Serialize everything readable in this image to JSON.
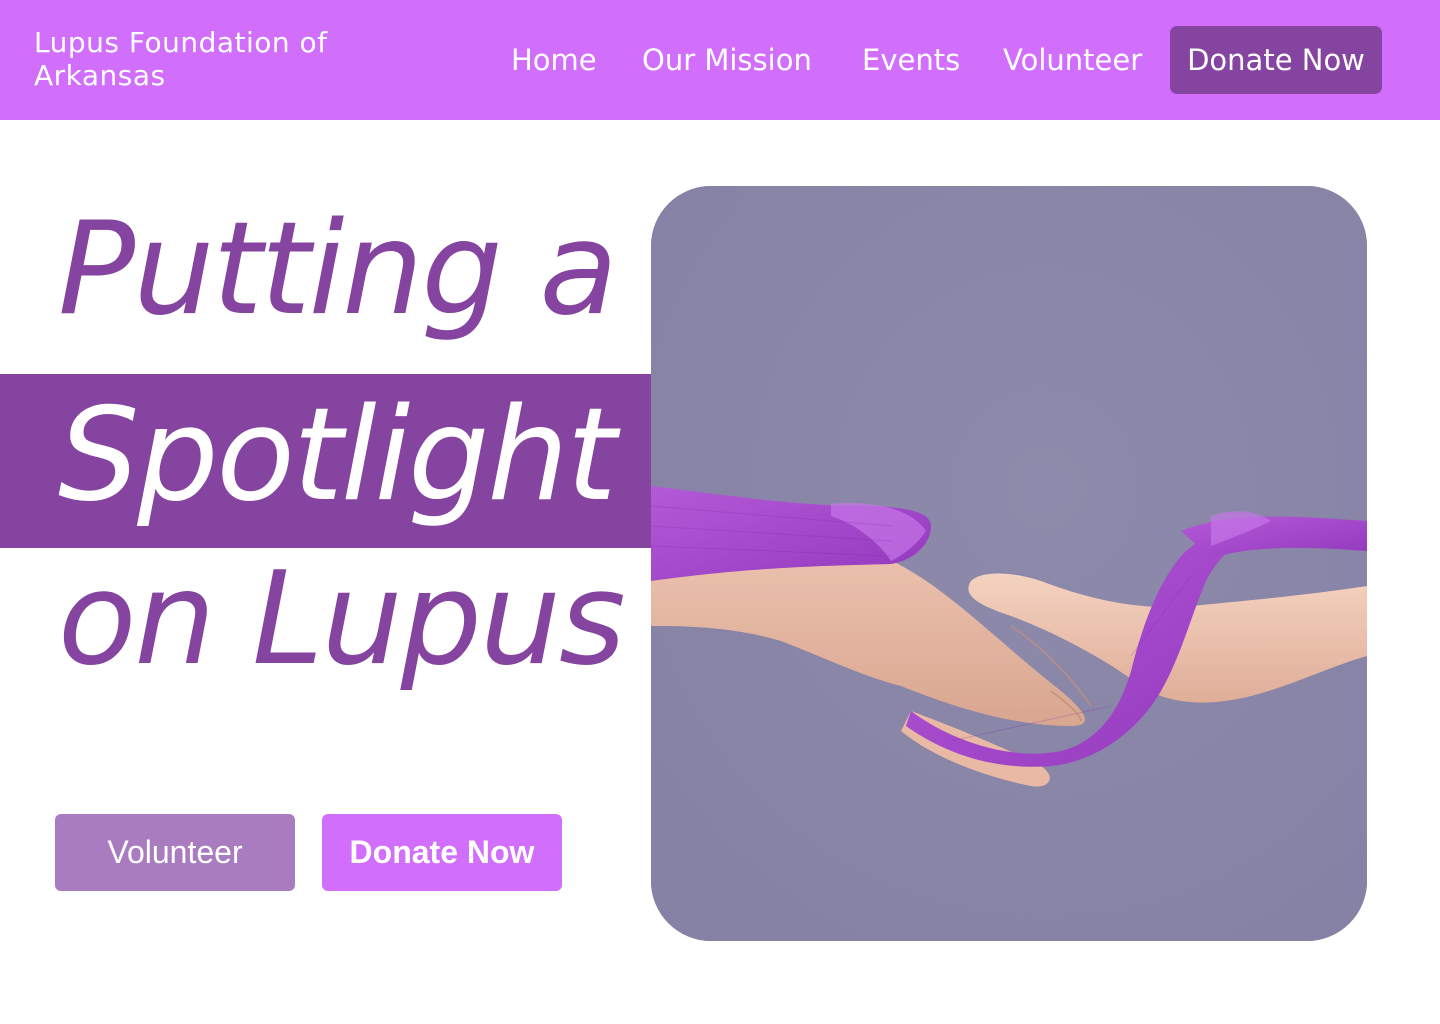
{
  "header": {
    "brand": "Lupus Foundation of Arkansas",
    "nav": {
      "home": "Home",
      "mission": "Our Mission",
      "events": "Events",
      "volunteer": "Volunteer",
      "donate": "Donate Now"
    }
  },
  "hero": {
    "headline": {
      "line1": "Putting a",
      "line2": "Spotlight",
      "line3": "on Lupus"
    },
    "cta": {
      "volunteer": "Volunteer",
      "donate": "Donate Now"
    }
  },
  "colors": {
    "header_bg": "#d16ffc",
    "accent_dark": "#8444a0",
    "volunteer_button": "#a97cc0",
    "donate_button": "#d16ffc",
    "photo_backdrop": "#8a85a8",
    "ribbon": "#a040c8"
  }
}
